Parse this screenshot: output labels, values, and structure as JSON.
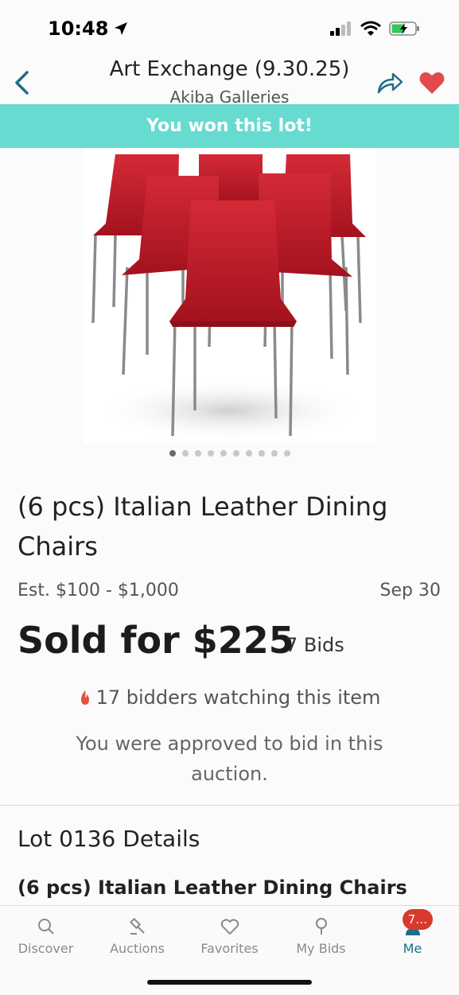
{
  "status_bar": {
    "time": "10:48"
  },
  "header": {
    "title": "Art Exchange (9.30.25)",
    "subtitle": "Akiba Galleries"
  },
  "banner": {
    "text": "You won this lot!"
  },
  "carousel": {
    "total": 10,
    "active_index": 0
  },
  "lot": {
    "title": "(6 pcs) Italian Leather Dining Chairs",
    "estimate": "Est. $100 - $1,000",
    "date": "Sep 30",
    "sold": "Sold for $225",
    "bids": "7 Bids",
    "watching": "17 bidders watching this item",
    "approved": "You were approved to bid in this auction."
  },
  "details": {
    "heading": "Lot 0136 Details",
    "title": "(6 pcs) Italian Leather Dining Chairs"
  },
  "tabbar": {
    "tabs": [
      {
        "label": "Discover",
        "icon": "search-icon"
      },
      {
        "label": "Auctions",
        "icon": "gavel-icon"
      },
      {
        "label": "Favorites",
        "icon": "heart-icon"
      },
      {
        "label": "My Bids",
        "icon": "paddle-icon"
      },
      {
        "label": "Me",
        "icon": "user-icon"
      }
    ],
    "me_badge": "7…"
  },
  "colors": {
    "banner": "#67dbd0",
    "accent": "#1d6f86",
    "heart": "#e14b4b",
    "badge": "#d93a2b",
    "fire": "#e0533d"
  }
}
